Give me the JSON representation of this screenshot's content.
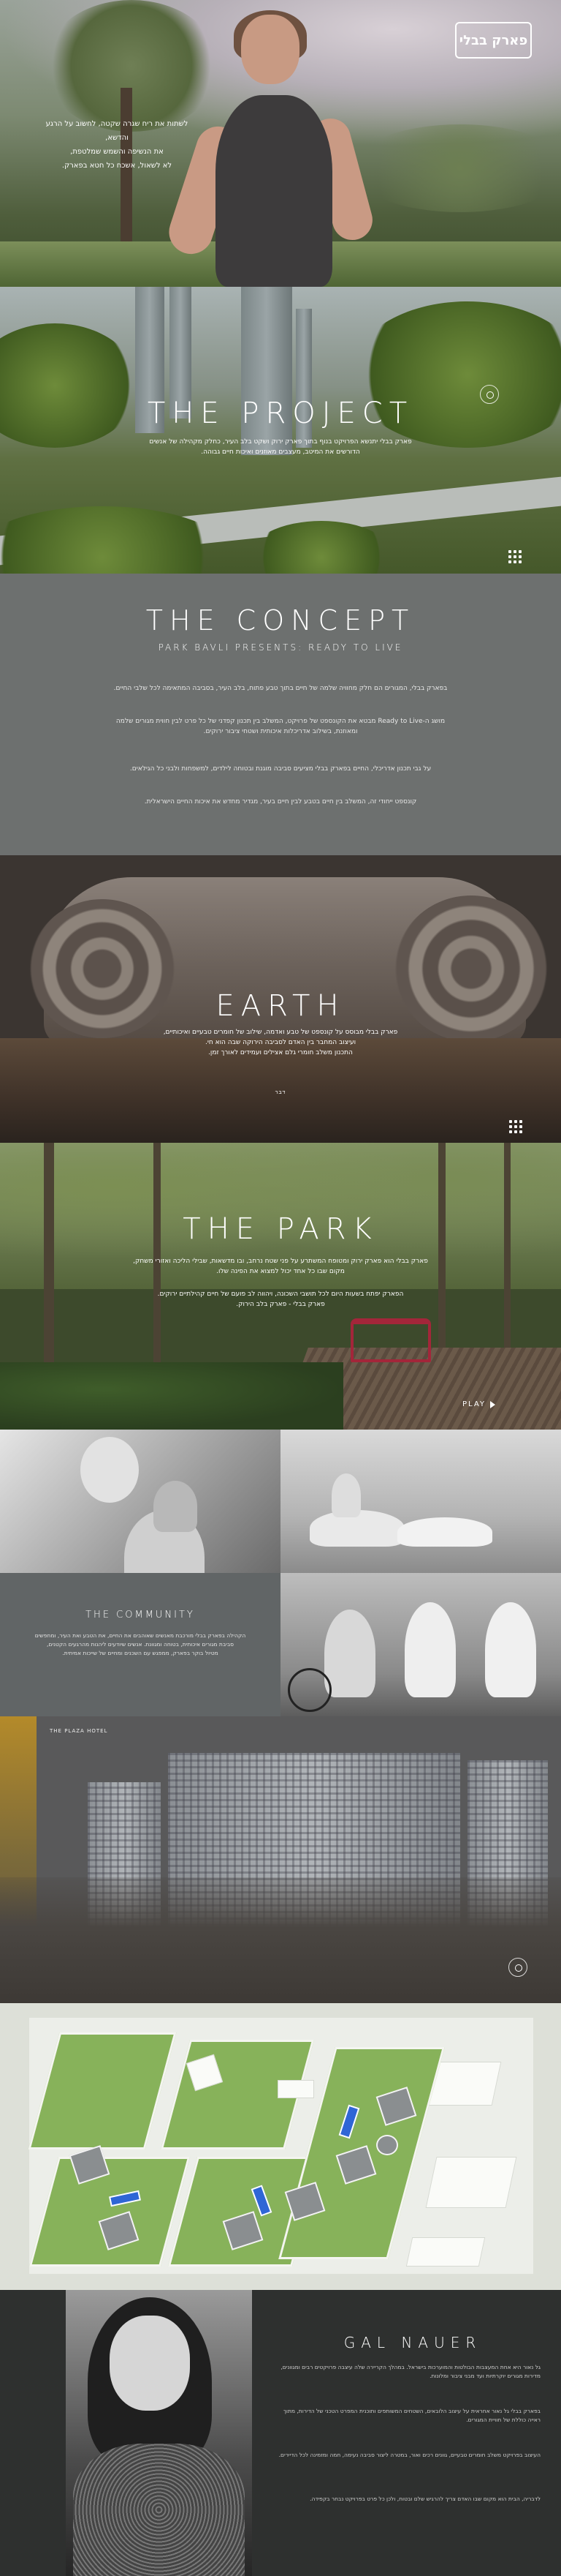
{
  "hero": {
    "logo": "פארק בבלי",
    "tagline_lines": [
      "לשתות את ריח שגרה שקטה, לחשוב על הרגע",
      "והדשא,",
      "את הנשיפה והשמש שמלטפת,",
      "לא לשאול, אשכח כל חטא בפארק."
    ]
  },
  "project": {
    "title": "THE PROJECT",
    "text_lines": [
      "פארק בבלי יתנשא הפרויקט בנוף בתוך פארק ירוק ושקט בלב העיר, כחלק מקהילה של אנשים",
      "הדורשים את המיטב, מעצבים מאוזנים ואיכות חיים גבוהה."
    ]
  },
  "concept": {
    "title": "THE CONCEPT",
    "subtitle": "PARK BAVLI PRESENTS: READY TO LIVE",
    "paragraphs": [
      "בפארק בבלי, המגורים הם חלק מחוויה שלמה של חיים בתוך טבע פתוח, בלב העיר, בסביבה המתאימה לכל שלבי החיים.",
      "מושג ה-Ready to Live מבטא את הקונספט של פרויקט, המשלב בין תכנון קפדני של כל פרט לבין חווית מגורים שלמה ומאוזנת, בשילוב אדריכלות איכותית ושטחי ציבור ירוקים.",
      "על גבי תכנון אדריכלי, החיים בפארק בבלי מציעים סביבה מוגנת ובטוחה לילדים, למשפחות ולבני כל הגילאים.",
      "קונספט ייחודי זה, המשלב בין חיים בטבע לבין חיים בעיר, מגדיר מחדש את איכות החיים הישראלית."
    ]
  },
  "earth": {
    "title": "EARTH",
    "text_lines": [
      "פארק בבלי מבוסס על קונספט של טבע ואדמה, שילוב של חומרים טבעיים ואיכותיים,",
      "ועיצוב המחבר בין האדם לסביבה הירוקה שבה הוא חי.",
      "התכנון משלב חומרי גלם אצילים ועמידים לאורך זמן."
    ],
    "caption": "דבר"
  },
  "park": {
    "title": "THE PARK",
    "text_lines": [
      "פארק בבלי הוא פארק ירוק ומטופח המשתרע על פני שטח נרחב, ובו מדשאות, שבילי הליכה ואזורי משחק,",
      "מקום שבו כל אחד יכול למצוא את הפינה שלו."
    ],
    "text2_lines": [
      "הפארק יפתח בשעות היום לכל תושבי השכונה, ויהווה לב פועם של חיים קהילתיים ירוקים.",
      "פארק בבלי - פארק בלב הירוק."
    ],
    "play_label": "PLAY"
  },
  "community": {
    "title": "THE COMMUNITY",
    "text_lines": [
      "הקהילה בפארק בבלי מורכבת מאנשים שאוהבים את החיים, את הטבע ואת העיר, ומחפשים",
      "סביבת מגורים איכותית, בטוחה ומגוונת. אנשים שיודעים ליהנות מהרגעים הקטנים,",
      "מטיול בוקר בפארק, ממפגש עם השכנים ומחיים של שייכות אמיתית."
    ]
  },
  "plaza": {
    "label": "THE PLAZA HOTEL"
  },
  "gal": {
    "title": "GAL NAUER",
    "paragraphs": [
      "גל נאור היא אחת המעצבות הבולטות והמוערכות בישראל. במהלך הקריירה שלה עיצבה פרויקטים רבים ומגוונים, מדירות מגורים יוקרתיות ועד מבני ציבור ומלונות.",
      "בפארק בבלי גל נאור אחראית על עיצוב הלובאים, השטחים המשותפים ותוכנית המפרט הטכני של הדירות, מתוך ראייה כוללת של חוויית המגורים.",
      "העיצוב בפרויקט משלב חומרים טבעיים, גוונים רכים ואור, במטרה ליצור סביבה נעימה, חמה ומזמינה לכל הדיירים.",
      "לדבריה, הבית הוא מקום שבו האדם צריך להרגיש שלם ובטוח, ולכן כל פרט בפרויקט נבחר בקפידה."
    ]
  }
}
